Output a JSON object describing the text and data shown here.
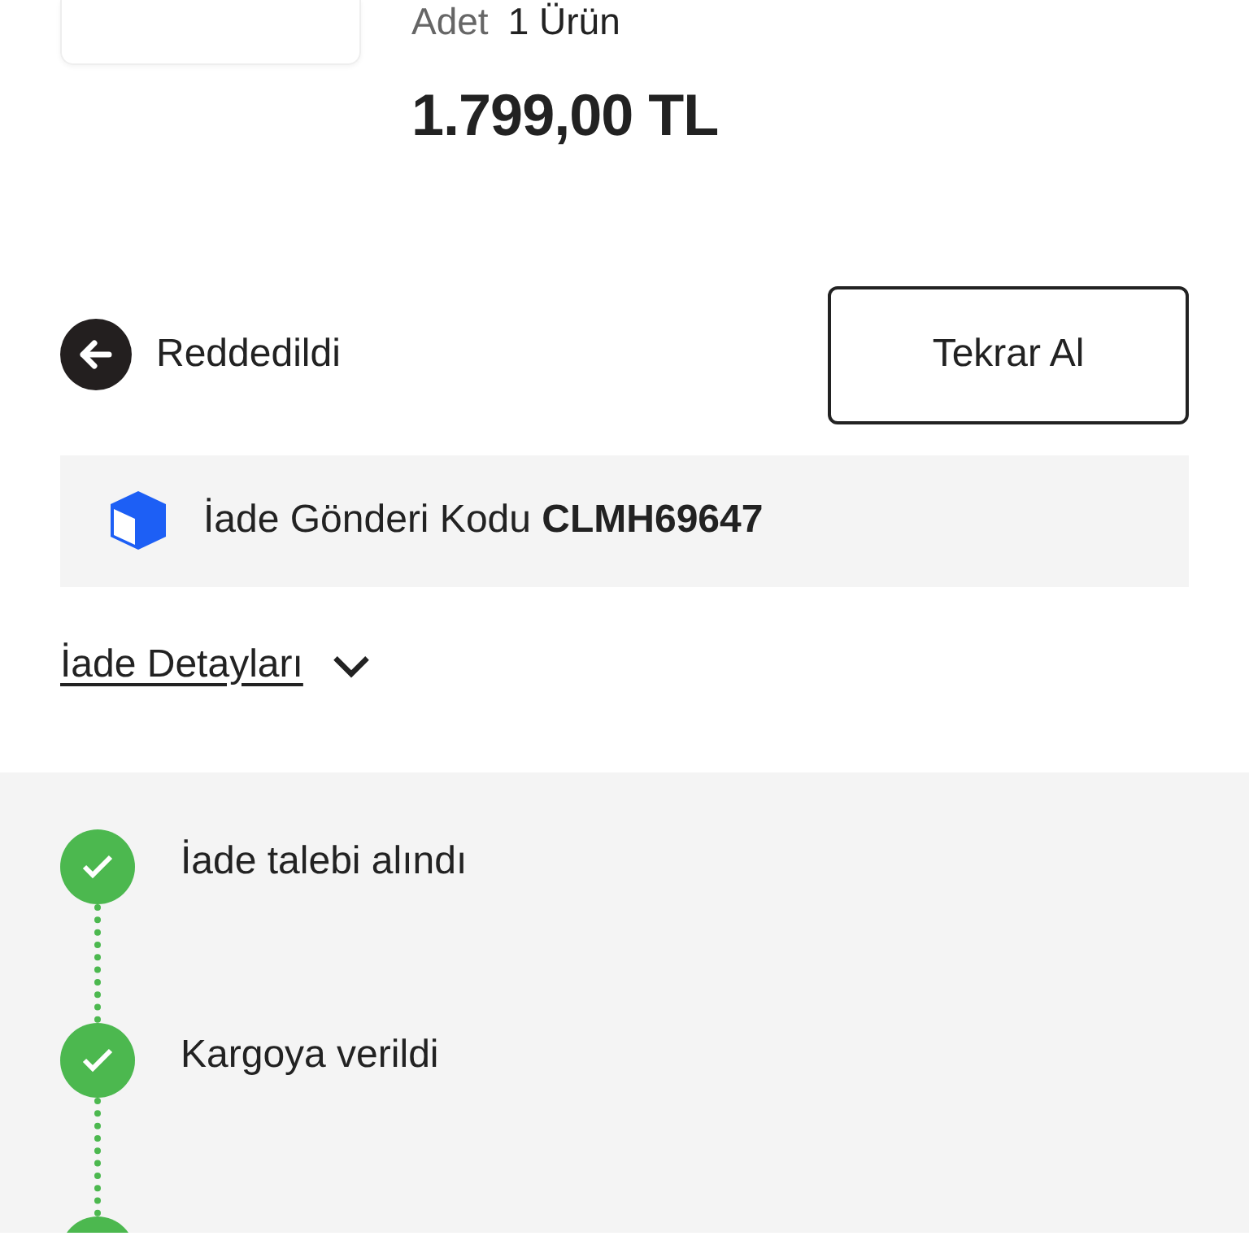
{
  "product": {
    "quantity_label": "Adet",
    "quantity": "1 Ürün",
    "price": "1.799,00 TL"
  },
  "status": {
    "kind": "rejected",
    "label": "Reddedildi"
  },
  "reorder_button": "Tekrar Al",
  "return_code": {
    "text": "İade Gönderi Kodu **CLMH69647**"
  },
  "details_link": {
    "label": "İade Detayları",
    "expanded": false
  },
  "steps": [
    {
      "label": "İade talebi alındı",
      "done": true
    },
    {
      "label": "Kargoya verildi",
      "done": true
    },
    {
      "done": true
    }
  ]
}
